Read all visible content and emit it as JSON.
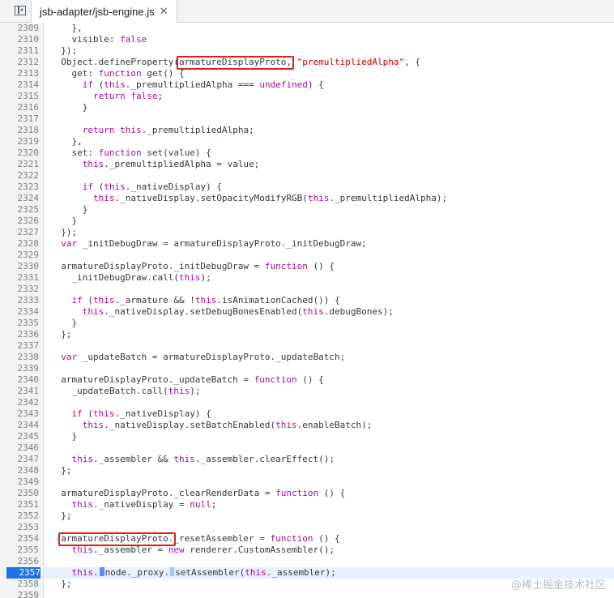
{
  "tab": {
    "title": "jsb-adapter/jsb-engine.js",
    "close_glyph": "✕"
  },
  "active_line": "2357",
  "lines": [
    [
      "2309",
      "    },"
    ],
    [
      "2310",
      "    visible: false"
    ],
    [
      "2311",
      "  });"
    ],
    [
      "2312",
      "  Object.defineProperty(armatureDisplayProto, \"premultipliedAlpha\", {"
    ],
    [
      "2313",
      "    get: function get() {"
    ],
    [
      "2314",
      "      if (this._premultipliedAlpha === undefined) {"
    ],
    [
      "2315",
      "        return false;"
    ],
    [
      "2316",
      "      }"
    ],
    [
      "2317",
      ""
    ],
    [
      "2318",
      "      return this._premultipliedAlpha;"
    ],
    [
      "2319",
      "    },"
    ],
    [
      "2320",
      "    set: function set(value) {"
    ],
    [
      "2321",
      "      this._premultipliedAlpha = value;"
    ],
    [
      "2322",
      ""
    ],
    [
      "2323",
      "      if (this._nativeDisplay) {"
    ],
    [
      "2324",
      "        this._nativeDisplay.setOpacityModifyRGB(this._premultipliedAlpha);"
    ],
    [
      "2325",
      "      }"
    ],
    [
      "2326",
      "    }"
    ],
    [
      "2327",
      "  });"
    ],
    [
      "2328",
      "  var _initDebugDraw = armatureDisplayProto._initDebugDraw;"
    ],
    [
      "2329",
      ""
    ],
    [
      "2330",
      "  armatureDisplayProto._initDebugDraw = function () {"
    ],
    [
      "2331",
      "    _initDebugDraw.call(this);"
    ],
    [
      "2332",
      ""
    ],
    [
      "2333",
      "    if (this._armature && !this.isAnimationCached()) {"
    ],
    [
      "2334",
      "      this._nativeDisplay.setDebugBonesEnabled(this.debugBones);"
    ],
    [
      "2335",
      "    }"
    ],
    [
      "2336",
      "  };"
    ],
    [
      "2337",
      ""
    ],
    [
      "2338",
      "  var _updateBatch = armatureDisplayProto._updateBatch;"
    ],
    [
      "2339",
      ""
    ],
    [
      "2340",
      "  armatureDisplayProto._updateBatch = function () {"
    ],
    [
      "2341",
      "    _updateBatch.call(this);"
    ],
    [
      "2342",
      ""
    ],
    [
      "2343",
      "    if (this._nativeDisplay) {"
    ],
    [
      "2344",
      "      this._nativeDisplay.setBatchEnabled(this.enableBatch);"
    ],
    [
      "2345",
      "    }"
    ],
    [
      "2346",
      ""
    ],
    [
      "2347",
      "    this._assembler && this._assembler.clearEffect();"
    ],
    [
      "2348",
      "  };"
    ],
    [
      "2349",
      ""
    ],
    [
      "2350",
      "  armatureDisplayProto._clearRenderData = function () {"
    ],
    [
      "2351",
      "    this._nativeDisplay = null;"
    ],
    [
      "2352",
      "  };"
    ],
    [
      "2353",
      ""
    ],
    [
      "2354",
      "  armatureDisplayProto._resetAssembler = function () {"
    ],
    [
      "2355",
      "    this._assembler = new renderer.CustomAssembler();"
    ],
    [
      "2356",
      ""
    ],
    [
      "2357",
      "    this.node._proxy.setAssembler(this._assembler);"
    ],
    [
      "2358",
      "  };"
    ],
    [
      "2359",
      ""
    ]
  ],
  "watermark": "@稀土掘金技术社区"
}
